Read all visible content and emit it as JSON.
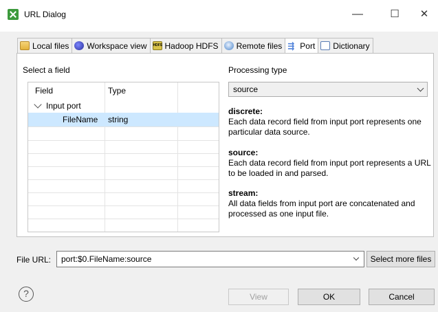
{
  "window": {
    "title": "URL Dialog",
    "icon": "url-dialog-icon",
    "minimize": "—",
    "maximize": "☐",
    "close": "✕"
  },
  "tabs": [
    {
      "label": "Local files",
      "icon": "folder-icon",
      "active": false
    },
    {
      "label": "Workspace view",
      "icon": "workspace-icon",
      "active": false
    },
    {
      "label": "Hadoop HDFS",
      "icon": "hdfs-icon",
      "active": false
    },
    {
      "label": "Remote files",
      "icon": "remote-icon",
      "active": false
    },
    {
      "label": "Port",
      "icon": "port-icon",
      "active": true
    },
    {
      "label": "Dictionary",
      "icon": "dictionary-icon",
      "active": false
    }
  ],
  "left": {
    "section_label": "Select a field",
    "columns": [
      "Field",
      "Type"
    ],
    "tree_parent": "Input port",
    "rows": [
      {
        "field": "FileName",
        "type": "string",
        "selected": true
      }
    ]
  },
  "right": {
    "section_label": "Processing type",
    "selected": "source",
    "descriptions": [
      {
        "title": "discrete:",
        "text": "Each data record field from input port represents one particular data source."
      },
      {
        "title": "source:",
        "text": "Each data record field from input port represents a URL to be loaded in and parsed."
      },
      {
        "title": "stream:",
        "text": "All data fields from input port are concatenated and processed as one input file."
      }
    ]
  },
  "file_url": {
    "label": "File URL:",
    "value": "port:$0.FileName:source",
    "select_more": "Select more files"
  },
  "buttons": {
    "help": "?",
    "view": "View",
    "ok": "OK",
    "cancel": "Cancel"
  },
  "colors": {
    "selection": "#cde8ff",
    "background": "#f0f0f0"
  }
}
